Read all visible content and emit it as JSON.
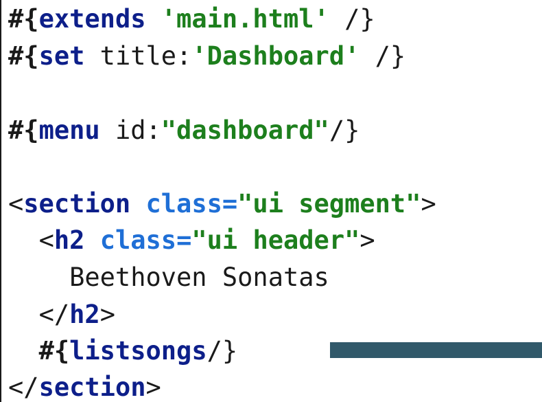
{
  "colors": {
    "keyword": "#0d1f8a",
    "string": "#1d7f1d",
    "attribute": "#1f6fd6",
    "text": "#1a1a1a",
    "scrollbar": "#31596a"
  },
  "code": {
    "line1": {
      "open": "#{",
      "kw": "extends",
      "sp": " ",
      "str": "'main.html'",
      "close": " /}"
    },
    "line2": {
      "open": "#{",
      "kw": "set",
      "mid": " title:",
      "str": "'Dashboard'",
      "close": " /}"
    },
    "line4": {
      "open": "#{",
      "kw": "menu",
      "mid": " id:",
      "str": "\"dashboard\"",
      "close": "/}"
    },
    "line6": {
      "lt": "<",
      "tag": "section",
      "sp": " ",
      "attr": "class=",
      "str": "\"ui segment\"",
      "gt": ">"
    },
    "line7": {
      "indent": "  ",
      "lt": "<",
      "tag": "h2",
      "sp": " ",
      "attr": "class=",
      "str": "\"ui header\"",
      "gt": ">"
    },
    "line8": {
      "text": "    Beethoven Sonatas"
    },
    "line9": {
      "indent": "  ",
      "lt": "</",
      "tag": "h2",
      "gt": ">"
    },
    "line10": {
      "indent": "  ",
      "open": "#{",
      "kw": "listsongs",
      "close": "/}"
    },
    "line11": {
      "lt": "</",
      "tag": "section",
      "gt": ">"
    }
  }
}
